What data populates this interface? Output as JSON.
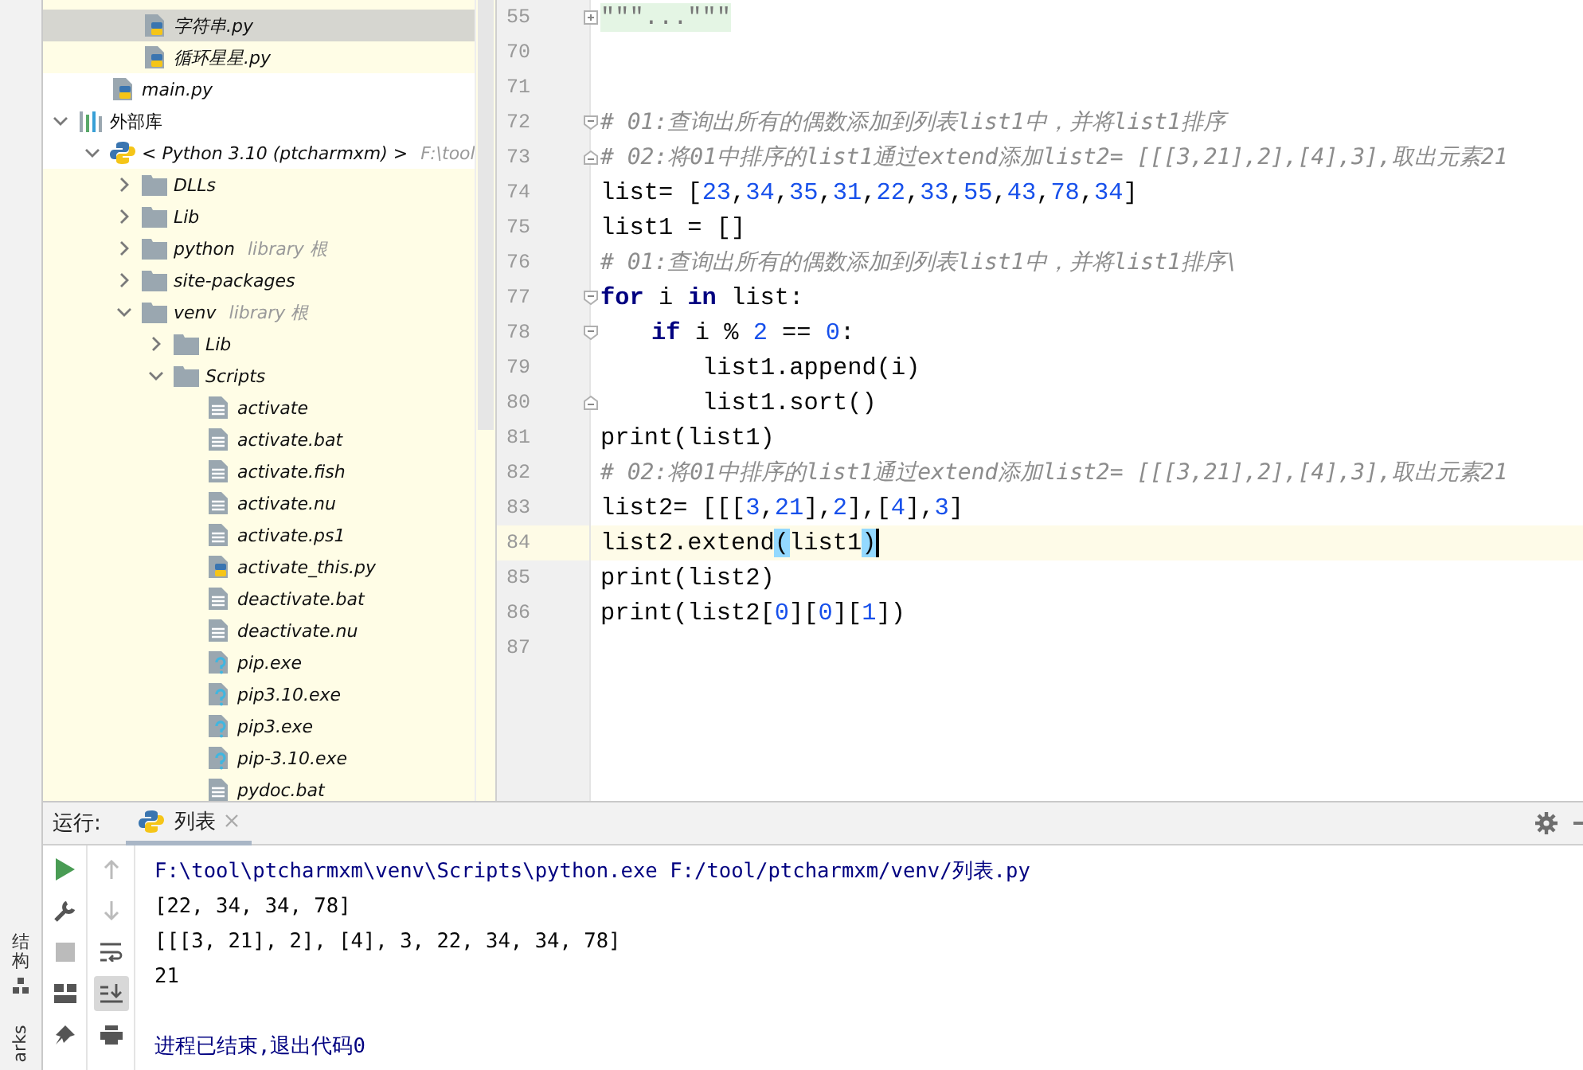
{
  "side_stripe": {
    "labels": [
      {
        "text": "结构",
        "kind": "cjk"
      },
      {
        "text": "arks",
        "kind": "latin"
      }
    ]
  },
  "project_tree": {
    "clipped_folder_items": [
      {
        "label": "字符串.py",
        "kind": "py",
        "selected": true,
        "library": true
      },
      {
        "label": "循环星星.py",
        "kind": "py",
        "selected": false,
        "library": true
      }
    ],
    "project_items": [
      {
        "label": "main.py",
        "kind": "py",
        "selected": false,
        "library": false
      }
    ],
    "items": [
      {
        "label": "外部库",
        "kind": "library",
        "selected": false,
        "library": false,
        "expanded": true,
        "children": [
          {
            "label": "< Python 3.10 (ptcharmxm) >",
            "hint": "F:\\tool",
            "kind": "python",
            "selected": false,
            "library": false,
            "expanded": true,
            "children": [
              {
                "label": "DLLs",
                "kind": "folder",
                "selected": false,
                "library": true,
                "expanded": false
              },
              {
                "label": "Lib",
                "kind": "folder",
                "selected": false,
                "library": true,
                "expanded": false
              },
              {
                "label": "python",
                "hint": "library 根",
                "kind": "folder",
                "selected": false,
                "library": true,
                "expanded": false
              },
              {
                "label": "site-packages",
                "kind": "folder",
                "selected": false,
                "library": true,
                "expanded": false
              },
              {
                "label": "venv",
                "hint": "library 根",
                "kind": "folder",
                "selected": false,
                "library": true,
                "expanded": true,
                "children": [
                  {
                    "label": "Lib",
                    "kind": "folder",
                    "selected": false,
                    "library": true,
                    "expanded": false
                  },
                  {
                    "label": "Scripts",
                    "kind": "folder",
                    "selected": false,
                    "library": true,
                    "expanded": true,
                    "children": [
                      {
                        "label": "activate",
                        "kind": "text",
                        "selected": false,
                        "library": true
                      },
                      {
                        "label": "activate.bat",
                        "kind": "text",
                        "selected": false,
                        "library": true
                      },
                      {
                        "label": "activate.fish",
                        "kind": "text",
                        "selected": false,
                        "library": true
                      },
                      {
                        "label": "activate.nu",
                        "kind": "text",
                        "selected": false,
                        "library": true
                      },
                      {
                        "label": "activate.ps1",
                        "kind": "text",
                        "selected": false,
                        "library": true
                      },
                      {
                        "label": "activate_this.py",
                        "kind": "py",
                        "selected": false,
                        "library": true
                      },
                      {
                        "label": "deactivate.bat",
                        "kind": "text",
                        "selected": false,
                        "library": true
                      },
                      {
                        "label": "deactivate.nu",
                        "kind": "text",
                        "selected": false,
                        "library": true
                      },
                      {
                        "label": "pip.exe",
                        "kind": "unknown",
                        "selected": false,
                        "library": true
                      },
                      {
                        "label": "pip3.10.exe",
                        "kind": "unknown",
                        "selected": false,
                        "library": true
                      },
                      {
                        "label": "pip3.exe",
                        "kind": "unknown",
                        "selected": false,
                        "library": true
                      },
                      {
                        "label": "pip-3.10.exe",
                        "kind": "unknown",
                        "selected": false,
                        "library": true
                      },
                      {
                        "label": "pydoc.bat",
                        "kind": "text",
                        "selected": false,
                        "library": true
                      }
                    ]
                  }
                ]
              }
            ]
          }
        ]
      }
    ]
  },
  "editor": {
    "lines": [
      {
        "number": "55",
        "kind": "folded",
        "current": false,
        "tokens": [
          {
            "t": "\"\"\"...\"\"\"",
            "kind": "folded"
          }
        ]
      },
      {
        "number": "70",
        "kind": "plain",
        "current": false
      },
      {
        "number": "71",
        "kind": "plain",
        "current": false
      },
      {
        "number": "72",
        "kind": "fold-start",
        "current": false,
        "tokens": [
          {
            "t": "# 01:查询出所有的偶数添加到列表list1中，并将list1排序",
            "kind": "comment"
          }
        ]
      },
      {
        "number": "73",
        "kind": "fold-end",
        "current": false,
        "tokens": [
          {
            "t": "# 02:将01中排序的list1通过extend添加list2= [[[3,21],2],[4],3],取出元素21",
            "kind": "comment"
          }
        ]
      },
      {
        "number": "74",
        "kind": "plain",
        "current": false,
        "tokens": [
          {
            "t": "list= [",
            "kind": "plain"
          },
          {
            "t": "23",
            "kind": "num"
          },
          {
            "t": ",",
            "kind": "plain"
          },
          {
            "t": "34",
            "kind": "num"
          },
          {
            "t": ",",
            "kind": "plain"
          },
          {
            "t": "35",
            "kind": "num"
          },
          {
            "t": ",",
            "kind": "plain"
          },
          {
            "t": "31",
            "kind": "num"
          },
          {
            "t": ",",
            "kind": "plain"
          },
          {
            "t": "22",
            "kind": "num"
          },
          {
            "t": ",",
            "kind": "plain"
          },
          {
            "t": "33",
            "kind": "num"
          },
          {
            "t": ",",
            "kind": "plain"
          },
          {
            "t": "55",
            "kind": "num"
          },
          {
            "t": ",",
            "kind": "plain"
          },
          {
            "t": "43",
            "kind": "num"
          },
          {
            "t": ",",
            "kind": "plain"
          },
          {
            "t": "78",
            "kind": "num"
          },
          {
            "t": ",",
            "kind": "plain"
          },
          {
            "t": "34",
            "kind": "num"
          },
          {
            "t": "]",
            "kind": "plain"
          }
        ]
      },
      {
        "number": "75",
        "kind": "plain",
        "current": false,
        "tokens": [
          {
            "t": "list1 = []",
            "kind": "plain"
          }
        ]
      },
      {
        "number": "76",
        "kind": "plain",
        "current": false,
        "tokens": [
          {
            "t": "# 01:查询出所有的偶数添加到列表list1中，并将list1排序\\",
            "kind": "comment"
          }
        ]
      },
      {
        "number": "77",
        "kind": "fold-start",
        "current": false,
        "tokens": [
          {
            "t": "for",
            "kind": "kw"
          },
          {
            "t": " i ",
            "kind": "plain"
          },
          {
            "t": "in",
            "kind": "kw"
          },
          {
            "t": " list:",
            "kind": "plain"
          }
        ],
        "children": [
          {
            "number": "78",
            "kind": "fold-start",
            "current": false,
            "tokens": [
              {
                "t": "if",
                "kind": "kw"
              },
              {
                "t": " i % ",
                "kind": "plain"
              },
              {
                "t": "2",
                "kind": "num"
              },
              {
                "t": " == ",
                "kind": "plain"
              },
              {
                "t": "0",
                "kind": "num"
              },
              {
                "t": ":",
                "kind": "plain"
              }
            ],
            "children": [
              {
                "number": "79",
                "kind": "plain",
                "current": false,
                "tokens": [
                  {
                    "t": "list1.append(i)",
                    "kind": "plain"
                  }
                ]
              },
              {
                "number": "80",
                "kind": "fold-end",
                "current": false,
                "tokens": [
                  {
                    "t": "list1.sort()",
                    "kind": "plain"
                  }
                ]
              }
            ]
          }
        ]
      },
      {
        "number": "81",
        "kind": "plain",
        "current": false,
        "tokens": [
          {
            "t": "print(list1)",
            "kind": "plain"
          }
        ]
      },
      {
        "number": "82",
        "kind": "plain",
        "current": false,
        "tokens": [
          {
            "t": "# 02:将01中排序的list1通过extend添加list2= [[[3,21],2],[4],3],取出元素21",
            "kind": "comment"
          }
        ]
      },
      {
        "number": "83",
        "kind": "plain",
        "current": false,
        "tokens": [
          {
            "t": "list2= [[[",
            "kind": "plain"
          },
          {
            "t": "3",
            "kind": "num"
          },
          {
            "t": ",",
            "kind": "plain"
          },
          {
            "t": "21",
            "kind": "num"
          },
          {
            "t": "],",
            "kind": "plain"
          },
          {
            "t": "2",
            "kind": "num"
          },
          {
            "t": "],[",
            "kind": "plain"
          },
          {
            "t": "4",
            "kind": "num"
          },
          {
            "t": "],",
            "kind": "plain"
          },
          {
            "t": "3",
            "kind": "num"
          },
          {
            "t": "]",
            "kind": "plain"
          }
        ]
      },
      {
        "number": "84",
        "kind": "plain",
        "current": true,
        "tokens": [
          {
            "t": "list2.extend",
            "kind": "plain"
          },
          {
            "t": "(",
            "kind": "brace"
          },
          {
            "t": "list1",
            "kind": "plain"
          },
          {
            "t": ")",
            "kind": "brace"
          }
        ]
      },
      {
        "number": "85",
        "kind": "plain",
        "current": false,
        "tokens": [
          {
            "t": "print(list2)",
            "kind": "plain"
          }
        ]
      },
      {
        "number": "86",
        "kind": "plain",
        "current": false,
        "tokens": [
          {
            "t": "print(list2[",
            "kind": "plain"
          },
          {
            "t": "0",
            "kind": "num"
          },
          {
            "t": "][",
            "kind": "plain"
          },
          {
            "t": "0",
            "kind": "num"
          },
          {
            "t": "][",
            "kind": "plain"
          },
          {
            "t": "1",
            "kind": "num"
          },
          {
            "t": "])",
            "kind": "plain"
          }
        ]
      },
      {
        "number": "87",
        "kind": "plain",
        "current": false
      }
    ]
  },
  "run_panel": {
    "label": "运行:",
    "tabs": [
      {
        "label": "列表",
        "selected": true
      }
    ],
    "scroll_to_end": true,
    "output": [
      {
        "text": "F:\\tool\\ptcharmxm\\venv\\Scripts\\python.exe F:/tool/ptcharmxm/venv/列表.py",
        "kind": "system"
      },
      {
        "text": "[22, 34, 34, 78]",
        "kind": "stdout"
      },
      {
        "text": "[[[3, 21], 2], [4], 3, 22, 34, 34, 78]",
        "kind": "stdout"
      },
      {
        "text": "21",
        "kind": "stdout"
      },
      {
        "kind": "blank"
      },
      {
        "text": "进程已结束,退出代码0",
        "kind": "system"
      }
    ]
  }
}
